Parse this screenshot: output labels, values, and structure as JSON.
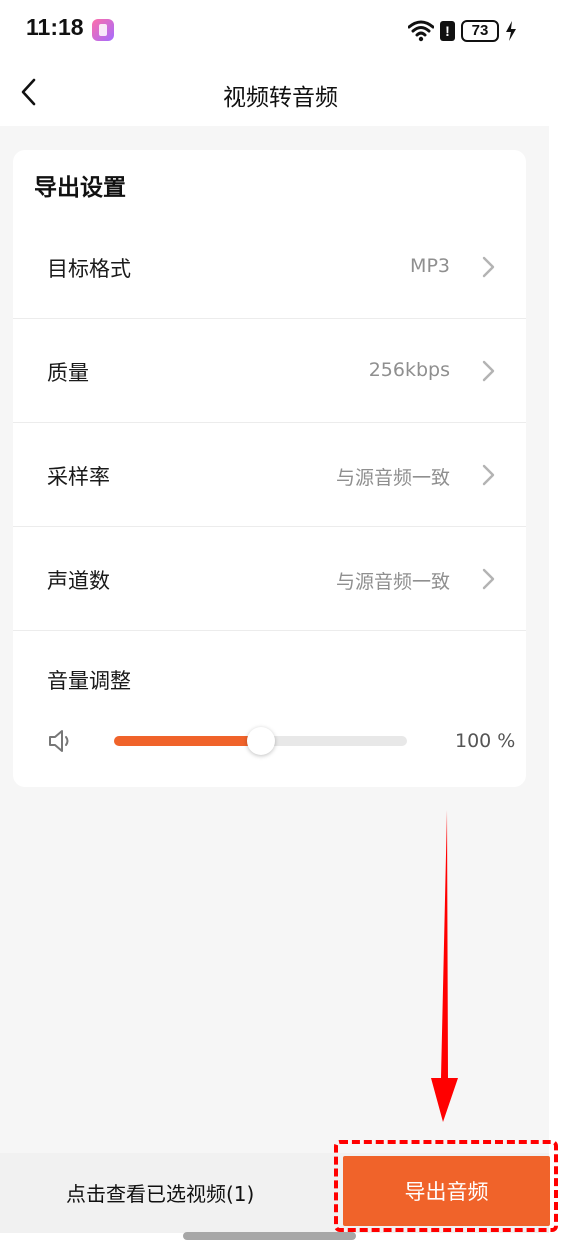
{
  "status": {
    "time": "11:18",
    "alert_glyph": "!",
    "battery": "73"
  },
  "nav": {
    "title": "视频转音频"
  },
  "settings": {
    "section_title": "导出设置",
    "rows": [
      {
        "label": "目标格式",
        "value": "MP3"
      },
      {
        "label": "质量",
        "value": "256kbps"
      },
      {
        "label": "采样率",
        "value": "与源音频一致"
      },
      {
        "label": "声道数",
        "value": "与源音频一致"
      }
    ],
    "volume": {
      "label": "音量调整",
      "value": "100 %",
      "slider_fraction": 0.5
    }
  },
  "bottom": {
    "view_selected": "点击查看已选视频(1)",
    "export_label": "导出音频"
  },
  "colors": {
    "accent": "#f0632a",
    "annotation": "#ff0000"
  },
  "icons": {
    "back": "chevron-left-icon",
    "row_arrow": "chevron-right-icon",
    "volume": "speaker-icon"
  }
}
